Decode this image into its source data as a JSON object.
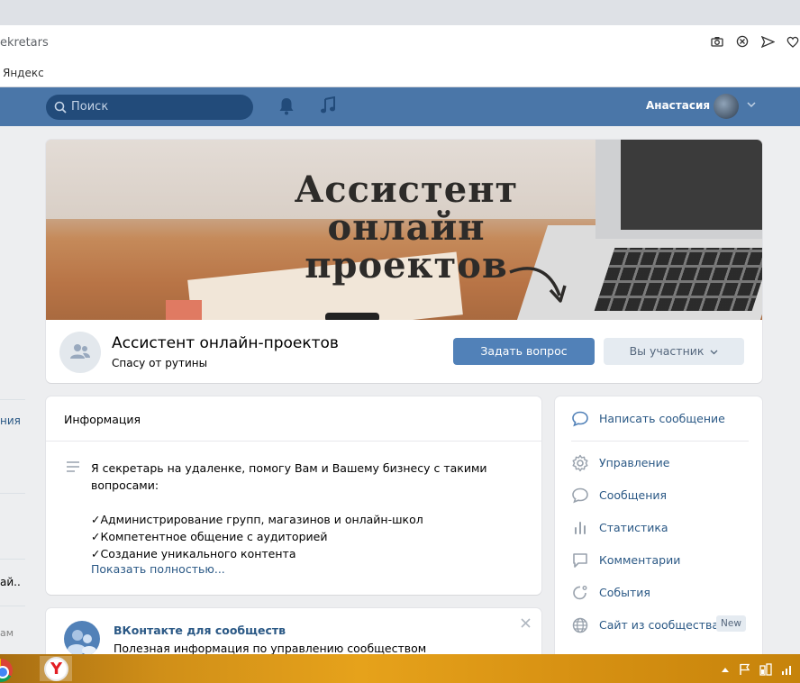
{
  "browser": {
    "address_fragment": "ekretars",
    "bookmark": "Яндекс"
  },
  "vk_header": {
    "search_placeholder": "Поиск",
    "user_name": "Анастасия"
  },
  "left_sidebar": {
    "fragments": [
      "ния",
      "ай..",
      "ам"
    ]
  },
  "cover": {
    "title_lines": [
      "Ассистент",
      "онлайн",
      "проектов"
    ]
  },
  "group": {
    "name": "Ассистент онлайн-проектов",
    "status": "Спасу от рутины",
    "ask_button": "Задать вопрос",
    "member_button": "Вы участник"
  },
  "info": {
    "heading": "Информация",
    "lines": [
      "Я секретарь на удаленке, помогу Вам и Вашему бизнесу с такими",
      "вопросами:",
      "",
      "✓Администрирование групп, магазинов и онлайн-школ",
      "✓Компетентное общение с аудиторией",
      "✓Создание уникального контента"
    ],
    "show_more": "Показать полностью..."
  },
  "vk_communities": {
    "title": "ВКонтакте для сообществ",
    "subtitle": "Полезная информация по управлению сообществом"
  },
  "menu": {
    "write_message": "Написать сообщение",
    "items": [
      {
        "label": "Управление",
        "icon": "gear-icon"
      },
      {
        "label": "Сообщения",
        "icon": "message-icon"
      },
      {
        "label": "Статистика",
        "icon": "bar-chart-icon"
      },
      {
        "label": "Комментарии",
        "icon": "comment-icon"
      },
      {
        "label": "События",
        "icon": "event-icon"
      },
      {
        "label": "Сайт из сообщества",
        "icon": "globe-icon"
      }
    ],
    "new_badge": "New"
  },
  "colors": {
    "vk_blue": "#4a76a8",
    "link": "#2a5885",
    "button": "#5181b8"
  }
}
